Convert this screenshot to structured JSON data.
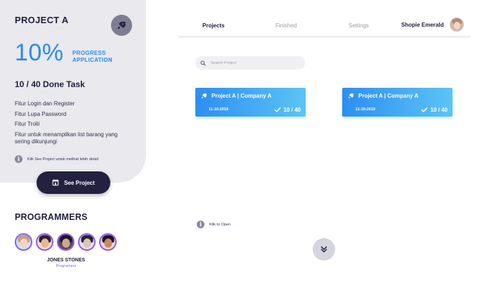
{
  "project": {
    "title": "PROJECT A",
    "percent": "10%",
    "percent_label_line1": "PROGRESS",
    "percent_label_line2": "APPLICATION",
    "done_task": "10 / 40 Done Task",
    "features": [
      "Fitur Login dan Register",
      "Fitur Lupa Password",
      "Fitur Trolli",
      "Fitur untuk menampilkan list barang yang sering dikunjungi"
    ],
    "hint": "Klik See Project untuk melihat lebih detail",
    "see_button": "See Project"
  },
  "programmers": {
    "title": "PROGRAMMERS",
    "selected_name": "JONES STONES",
    "selected_role": "Programers",
    "avatars": [
      {
        "hair": "#caa07a",
        "face": "#f4d4be",
        "bg": "#c9e4f5"
      },
      {
        "hair": "#2f2622",
        "face": "#e8b79a",
        "bg": "#fbd9c4"
      },
      {
        "hair": "#1d1a1a",
        "face": "#c9a98f",
        "bg": "#5c4a55"
      },
      {
        "hair": "#2b2626",
        "face": "#d9c7be",
        "bg": "#e9e2e2"
      },
      {
        "hair": "#1d1515",
        "face": "#c48a6c",
        "bg": "#eed8c8"
      }
    ]
  },
  "nav": {
    "tabs": [
      "Projects",
      "Finished",
      "Settings"
    ],
    "active_tab": "Projects",
    "user_name": "Shopie Emerald"
  },
  "search": {
    "placeholder": "Search Project"
  },
  "cards": [
    {
      "title": "Project A | Company A",
      "date": "11-10-2019",
      "count": "10 / 40"
    },
    {
      "title": "Project A | Company A",
      "date": "11-10-2019",
      "count": "10 / 40"
    }
  ],
  "open_hint": "Klik to Open",
  "colors": {
    "accent_blue": "#2b8be6",
    "card_gradient_start": "#2d8ef2",
    "card_gradient_end": "#5bc4f5",
    "dark_button": "#23213f",
    "avatar_ring": "#8b5cf6",
    "side_panel": "#e9e9ee"
  }
}
